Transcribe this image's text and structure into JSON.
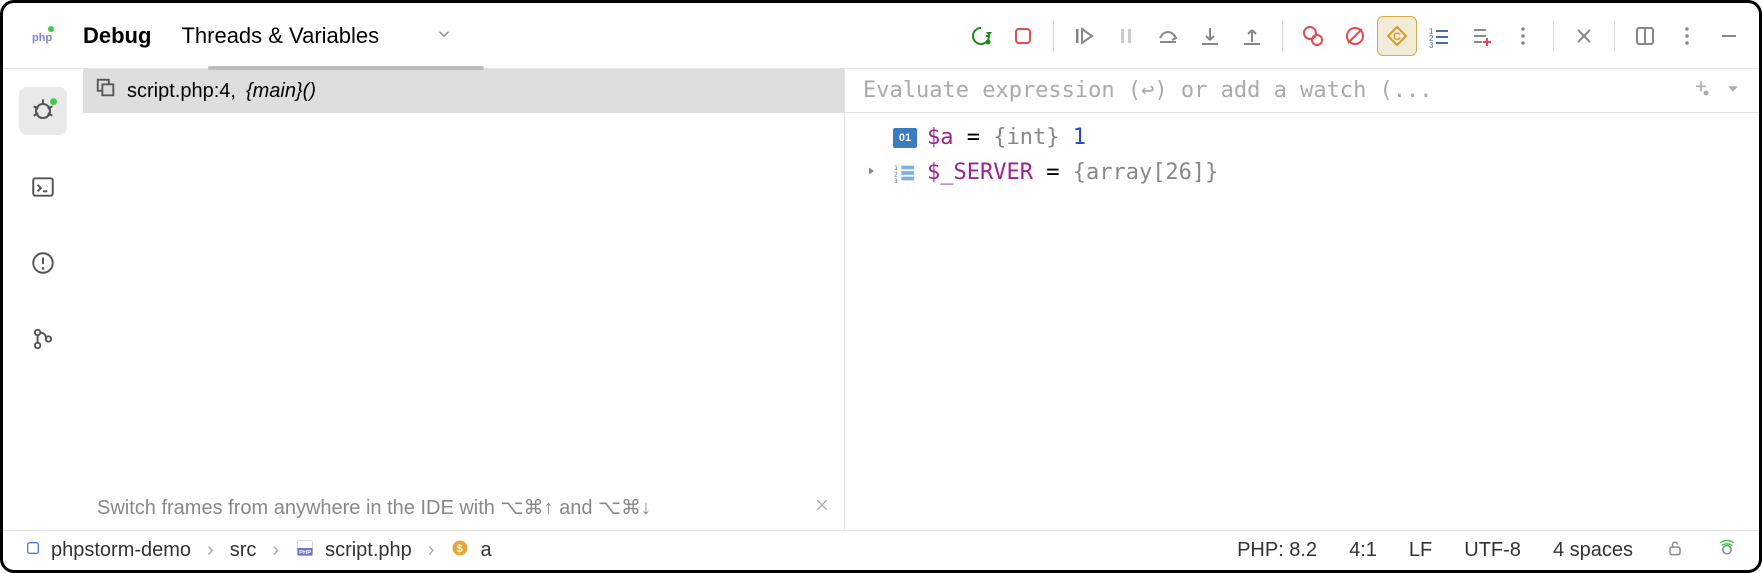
{
  "header": {
    "debug_label": "Debug",
    "threads_tab": "Threads & Variables"
  },
  "frames": {
    "file": "script.php:4,",
    "main": "{main}()",
    "hint": "Switch frames from anywhere in the IDE with ⌥⌘↑ and ⌥⌘↓"
  },
  "watch": {
    "placeholder": "Evaluate expression (↩) or add a watch (..."
  },
  "vars": [
    {
      "name": "$a",
      "eq": " = ",
      "type": "{int}",
      "value": " 1",
      "icon": "int",
      "expandable": false
    },
    {
      "name": "$_SERVER",
      "eq": " = ",
      "type": "{array[26]}",
      "value": "",
      "icon": "arr",
      "expandable": true
    }
  ],
  "breadcrumb": {
    "project": "phpstorm-demo",
    "dir": "src",
    "file": "script.php",
    "symbol": "a"
  },
  "status": {
    "php": "PHP: 8.2",
    "pos": "4:1",
    "eol": "LF",
    "enc": "UTF-8",
    "indent": "4 spaces"
  }
}
